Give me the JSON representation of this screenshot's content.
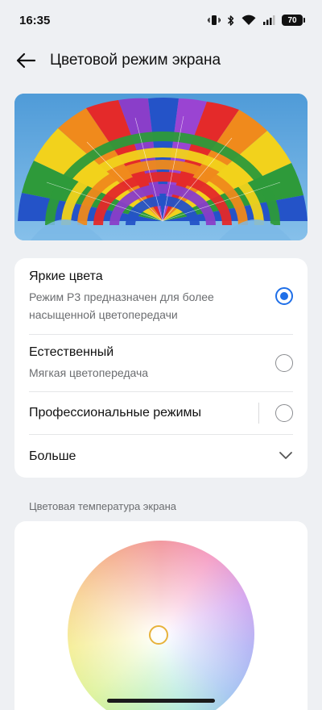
{
  "status_bar": {
    "time": "16:35",
    "battery": "70",
    "icons": [
      "vibrate-icon",
      "bluetooth-icon",
      "wifi-icon",
      "signal-icon",
      "battery-icon"
    ]
  },
  "header": {
    "title": "Цветовой режим экрана",
    "back_icon": "back-arrow-icon"
  },
  "modes": {
    "items": [
      {
        "title": "Яркие цвета",
        "subtitle": "Режим P3 предназначен для более насыщенной цветопередачи",
        "selected": true
      },
      {
        "title": "Естественный",
        "subtitle": "Мягкая цветопередача",
        "selected": false
      },
      {
        "title": "Профессиональные режимы",
        "subtitle": "",
        "selected": false
      }
    ],
    "more_label": "Больше"
  },
  "temperature": {
    "section_label": "Цветовая температура экрана"
  },
  "colors": {
    "accent": "#1f6fe8",
    "background": "#eef0f3",
    "card": "#ffffff",
    "handle": "#e7b23b"
  }
}
